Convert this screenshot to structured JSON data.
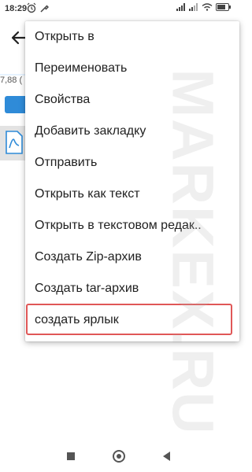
{
  "status_bar": {
    "time": "18:29",
    "left_icons": [
      "alarm-icon",
      "wrench-icon"
    ],
    "right_icons": [
      "signal-icon",
      "signal-icon",
      "wifi-icon",
      "battery-icon"
    ]
  },
  "app_bar": {
    "back_icon": "back-arrow-icon"
  },
  "background_content": {
    "size_text": "7,88 (",
    "folder_icon_color": "#2f8bd8",
    "file_icon": "pdf-file-icon"
  },
  "menu": {
    "items": [
      {
        "label": "Открыть в"
      },
      {
        "label": "Переименовать"
      },
      {
        "label": "Свойства"
      },
      {
        "label": "Добавить закладку"
      },
      {
        "label": "Отправить"
      },
      {
        "label": "Открыть как текст"
      },
      {
        "label": "Открыть в текстовом редак.."
      },
      {
        "label": "Создать Zip-архив"
      },
      {
        "label": "Создать tar-архив"
      },
      {
        "label": "создать ярлык",
        "highlighted": true
      }
    ],
    "highlight_color": "#e05757"
  },
  "watermark": {
    "text": "MARKEX.RU"
  },
  "nav_bar": {
    "icons": [
      "recents-square-icon",
      "home-circle-icon",
      "back-triangle-icon"
    ]
  }
}
